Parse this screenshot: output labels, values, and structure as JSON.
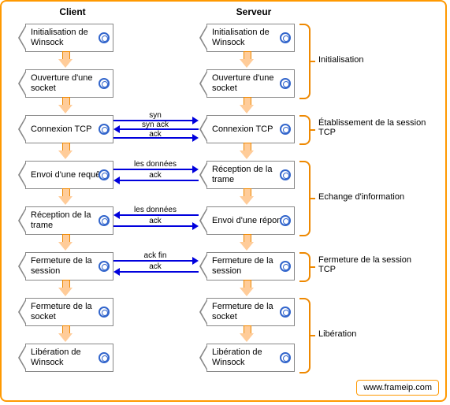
{
  "columns": {
    "client": "Client",
    "server": "Serveur"
  },
  "client_steps": [
    "Initialisation de Winsock",
    "Ouverture d'une socket",
    "Connexion TCP",
    "Envoi d'une requête",
    "Réception de la trame",
    "Fermeture de la session",
    "Fermeture de la socket",
    "Libération de Winsock"
  ],
  "server_steps": [
    "Initialisation de Winsock",
    "Ouverture d'une socket",
    "Connexion TCP",
    "Réception de la trame",
    "Envoi d'une réponse",
    "Fermeture de la session",
    "Fermeture de la socket",
    "Libération de Winsock"
  ],
  "exchanges": {
    "tcp": [
      "syn",
      "syn ack",
      "ack"
    ],
    "req": [
      "les données",
      "ack"
    ],
    "resp": [
      "les données",
      "ack"
    ],
    "close": [
      "ack fin",
      "ack"
    ]
  },
  "phases": [
    "Initialisation",
    "Établissement de la session TCP",
    "Echange d'information",
    "Fermeture de la session TCP",
    "Libération"
  ],
  "footer": "www.frameip.com"
}
